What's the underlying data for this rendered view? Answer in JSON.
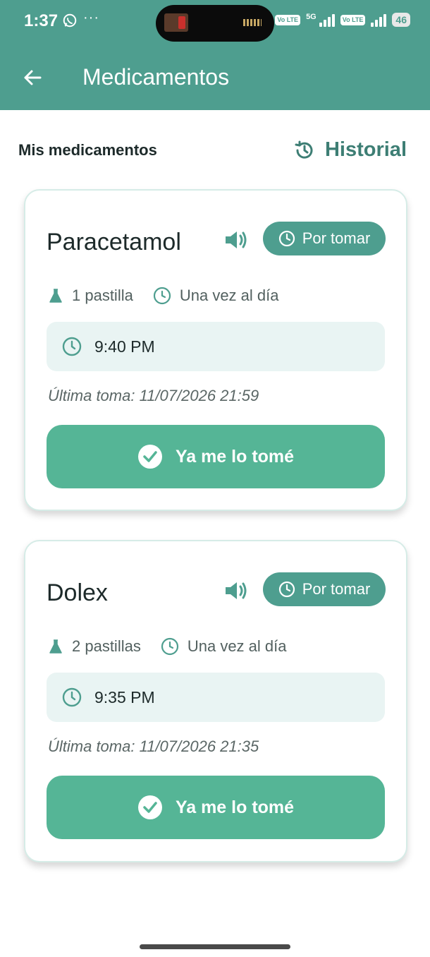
{
  "status_bar": {
    "time": "1:37",
    "dots": "···",
    "volte_1": "Vo LTE",
    "network": "5G",
    "volte_2": "Vo LTE",
    "battery": "46"
  },
  "app_bar": {
    "title": "Medicamentos",
    "back_icon": "arrow-left-icon"
  },
  "section": {
    "title": "Mis medicamentos",
    "history_label": "Historial",
    "history_icon": "history-icon"
  },
  "medications": [
    {
      "name": "Paracetamol",
      "status": "Por tomar",
      "dose": "1 pastilla",
      "frequency": "Una vez al día",
      "time": "9:40 PM",
      "last_taken": "Última toma: 11/07/2026 21:59",
      "action_label": "Ya me lo tomé"
    },
    {
      "name": "Dolex",
      "status": "Por tomar",
      "dose": "2 pastillas",
      "frequency": "Una vez al día",
      "time": "9:35 PM",
      "last_taken": "Última toma: 11/07/2026 21:35",
      "action_label": "Ya me lo tomé"
    }
  ],
  "colors": {
    "primary": "#4e9e8f",
    "button": "#55b596",
    "time_box": "#e9f4f3",
    "accent_text": "#3d7e74"
  }
}
